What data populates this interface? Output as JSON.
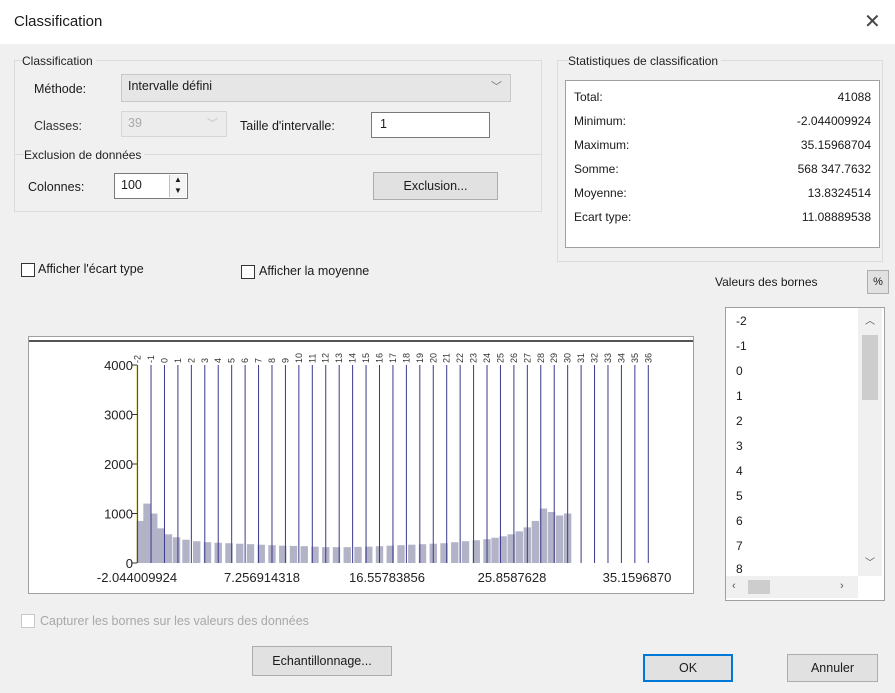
{
  "window": {
    "title": "Classification",
    "close_glyph": "✕"
  },
  "classification": {
    "group_label": "Classification",
    "method_label": "Méthode:",
    "method_value": "Intervalle défini",
    "classes_label": "Classes:",
    "classes_value": "39",
    "interval_label": "Taille d'intervalle:",
    "interval_value": "1"
  },
  "exclusion": {
    "group_label": "Exclusion de données",
    "columns_label": "Colonnes:",
    "columns_value": "100",
    "button": "Exclusion..."
  },
  "stats": {
    "group_label": "Statistiques de classification",
    "rows": [
      {
        "label": "Total:",
        "value": "41088"
      },
      {
        "label": "Minimum:",
        "value": "-2.044009924"
      },
      {
        "label": "Maximum:",
        "value": "35.15968704"
      },
      {
        "label": "Somme:",
        "value": "568 347.7632"
      },
      {
        "label": "Moyenne:",
        "value": "13.8324514"
      },
      {
        "label": "Ecart type:",
        "value": "11.08889538"
      }
    ]
  },
  "options": {
    "show_std": "Afficher l'écart type",
    "show_mean": "Afficher la moyenne",
    "snap": "Capturer les bornes sur les valeurs des données"
  },
  "breaks": {
    "label": "Valeurs des bornes",
    "percent_button": "%",
    "values": [
      "-2",
      "-1",
      "0",
      "1",
      "2",
      "3",
      "4",
      "5",
      "6",
      "7",
      "8"
    ]
  },
  "buttons": {
    "sampling": "Echantillonnage...",
    "ok": "OK",
    "cancel": "Annuler"
  },
  "chart_data": {
    "type": "bar",
    "bar_color": "#b3b3c8",
    "break_color": "#3a3a8c",
    "min_line_color": "#e8e89a",
    "ylim": [
      0,
      4000
    ],
    "xlim": [
      -2.044009924,
      35.15968704
    ],
    "y_ticks": [
      "4000",
      "3000",
      "2000",
      "1000",
      "0"
    ],
    "x_ticks": [
      "-2.044009924",
      "7.256914318",
      "16.55783856",
      "25.8587628",
      "35.1596870"
    ],
    "break_values": [
      -2,
      -1,
      0,
      1,
      2,
      3,
      4,
      5,
      6,
      7,
      8,
      9,
      10,
      11,
      12,
      13,
      14,
      15,
      16,
      17,
      18,
      19,
      20,
      21,
      22,
      23,
      24,
      25,
      26,
      27,
      28,
      29,
      30,
      31,
      32,
      33,
      34,
      35,
      36
    ],
    "break_labels": [
      "-2",
      "-1",
      "0",
      "1",
      "2",
      "3",
      "4",
      "5",
      "6",
      "7",
      "8",
      "9",
      "10",
      "11",
      "12",
      "13",
      "14",
      "15",
      "16",
      "17",
      "18",
      "19",
      "20",
      "21",
      "22",
      "23",
      "24",
      "25",
      "26",
      "27",
      "28",
      "29",
      "30",
      "31",
      "32",
      "33",
      "34",
      "35",
      "36"
    ],
    "bins": [
      {
        "x": -1.8,
        "y": 850
      },
      {
        "x": -1.3,
        "y": 1200
      },
      {
        "x": -0.8,
        "y": 1000
      },
      {
        "x": -0.3,
        "y": 700
      },
      {
        "x": 0.3,
        "y": 580
      },
      {
        "x": 0.9,
        "y": 520
      },
      {
        "x": 1.6,
        "y": 470
      },
      {
        "x": 2.4,
        "y": 440
      },
      {
        "x": 3.2,
        "y": 420
      },
      {
        "x": 4.0,
        "y": 410
      },
      {
        "x": 4.8,
        "y": 400
      },
      {
        "x": 5.6,
        "y": 390
      },
      {
        "x": 6.4,
        "y": 380
      },
      {
        "x": 7.2,
        "y": 370
      },
      {
        "x": 8.0,
        "y": 360
      },
      {
        "x": 8.8,
        "y": 350
      },
      {
        "x": 9.6,
        "y": 345
      },
      {
        "x": 10.4,
        "y": 340
      },
      {
        "x": 11.2,
        "y": 330
      },
      {
        "x": 12.0,
        "y": 320
      },
      {
        "x": 12.8,
        "y": 320
      },
      {
        "x": 13.6,
        "y": 320
      },
      {
        "x": 14.4,
        "y": 325
      },
      {
        "x": 15.2,
        "y": 330
      },
      {
        "x": 16.0,
        "y": 340
      },
      {
        "x": 16.8,
        "y": 350
      },
      {
        "x": 17.6,
        "y": 360
      },
      {
        "x": 18.4,
        "y": 370
      },
      {
        "x": 19.2,
        "y": 380
      },
      {
        "x": 20.0,
        "y": 390
      },
      {
        "x": 20.8,
        "y": 400
      },
      {
        "x": 21.6,
        "y": 420
      },
      {
        "x": 22.4,
        "y": 440
      },
      {
        "x": 23.2,
        "y": 460
      },
      {
        "x": 24.0,
        "y": 480
      },
      {
        "x": 24.6,
        "y": 510
      },
      {
        "x": 25.2,
        "y": 540
      },
      {
        "x": 25.8,
        "y": 580
      },
      {
        "x": 26.4,
        "y": 640
      },
      {
        "x": 27.0,
        "y": 720
      },
      {
        "x": 27.6,
        "y": 850
      },
      {
        "x": 28.2,
        "y": 1100
      },
      {
        "x": 28.8,
        "y": 1030
      },
      {
        "x": 29.4,
        "y": 960
      },
      {
        "x": 30.0,
        "y": 1000
      }
    ]
  }
}
